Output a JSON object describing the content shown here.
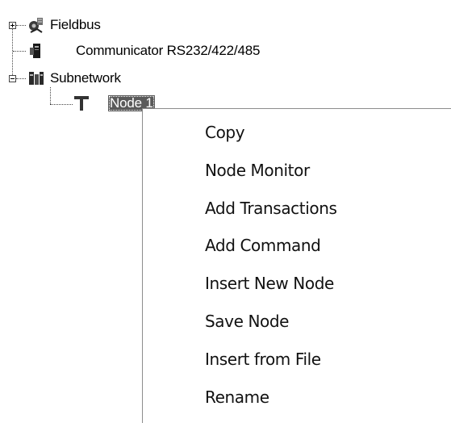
{
  "tree": {
    "nodes": [
      {
        "label": "Fieldbus",
        "icon": "fieldbus-icon",
        "expander": "collapsed"
      },
      {
        "label": "Communicator RS232/422/485",
        "icon": "communicator-icon",
        "expander": ""
      },
      {
        "label": "Subnetwork",
        "icon": "subnetwork-icon",
        "expander": "expanded"
      },
      {
        "label": "Node 1",
        "icon": "node-icon",
        "expander": "",
        "selected": true
      }
    ]
  },
  "context_menu": {
    "items": [
      {
        "label": "Copy"
      },
      {
        "label": "Node Monitor"
      },
      {
        "label": "Add Transactions"
      },
      {
        "label": "Add Command"
      },
      {
        "label": "Insert New Node"
      },
      {
        "label": "Save Node"
      },
      {
        "label": "Insert from File"
      },
      {
        "label": "Rename"
      }
    ]
  }
}
